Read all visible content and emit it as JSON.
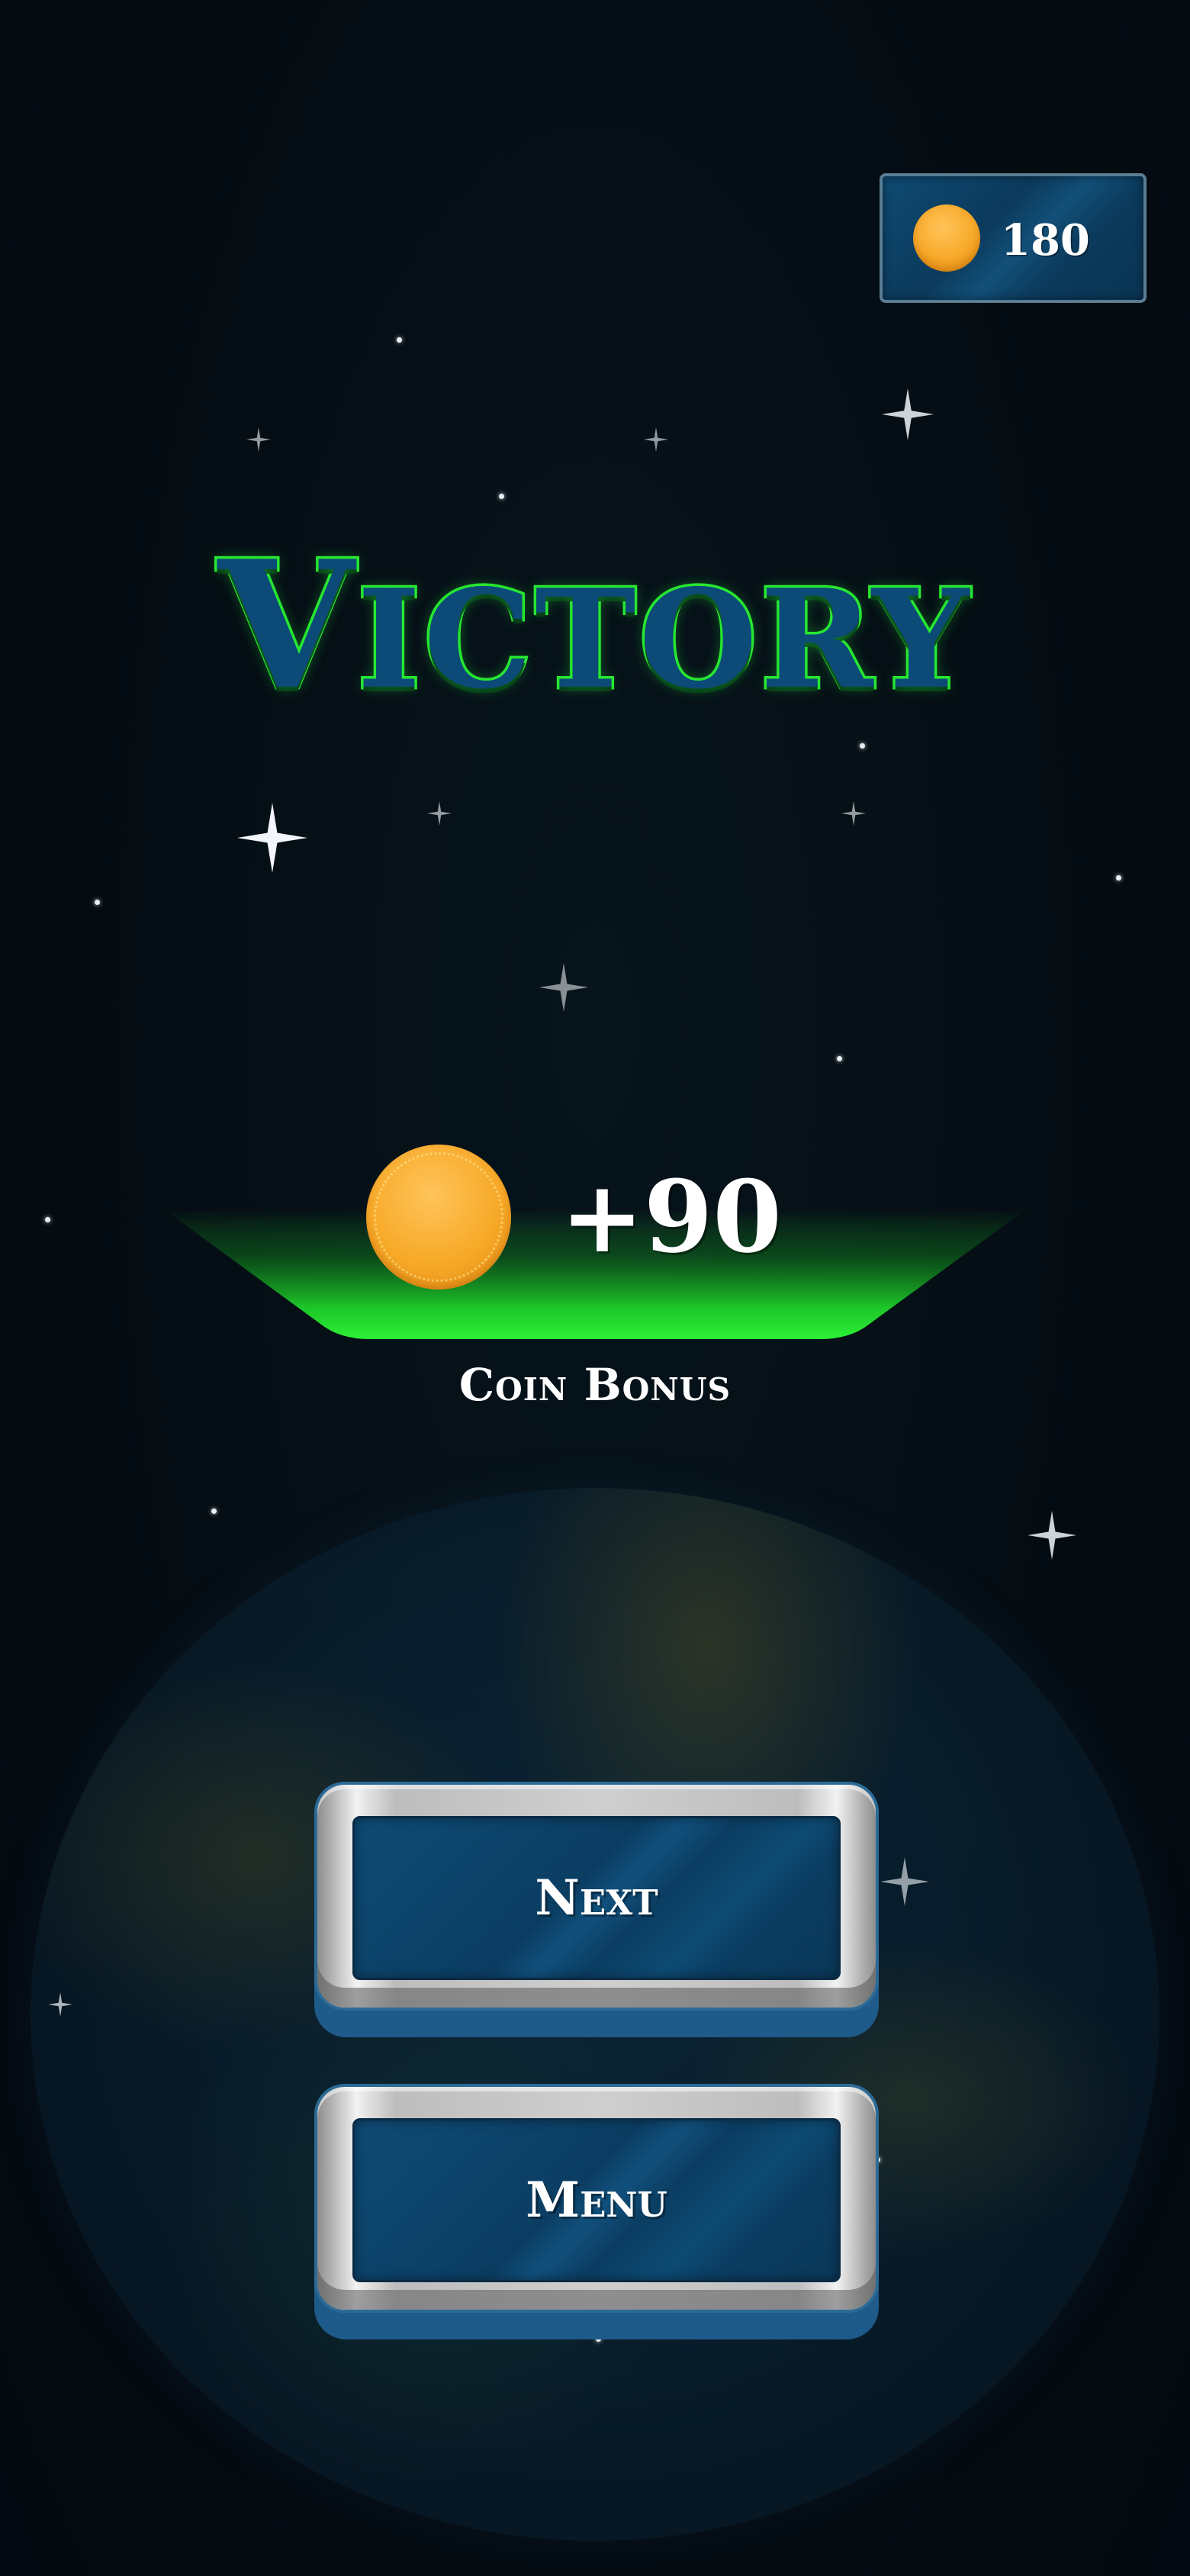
{
  "hud": {
    "coin_total": "180"
  },
  "title": "Victory",
  "reward": {
    "amount": "+90",
    "label": "Coin Bonus"
  },
  "buttons": {
    "next_label": "Next",
    "menu_label": "Menu"
  },
  "colors": {
    "title_fill": "#0c4a78",
    "title_outline": "#27e82f",
    "reward_glow": "#1fd82a",
    "coin": "#f7a928",
    "panel_blue": "#0b3d62",
    "metal": "#cfcfcf",
    "background": "#050d13"
  },
  "icons": {
    "coin": "coin-icon",
    "star": "sparkle-star"
  }
}
